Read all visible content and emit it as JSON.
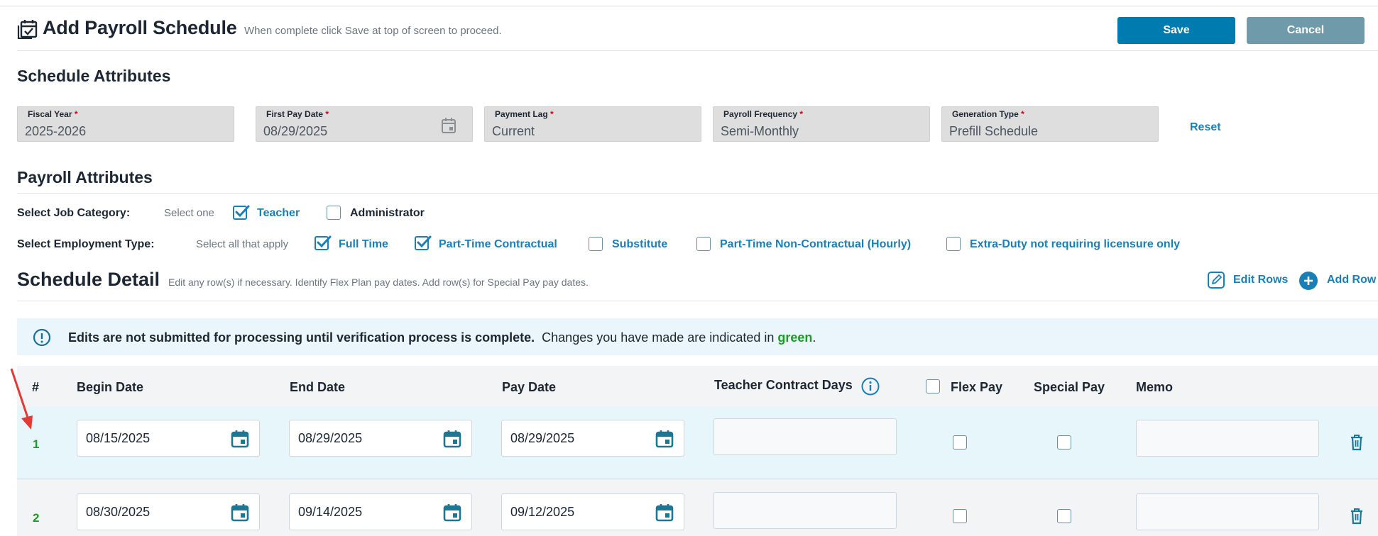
{
  "header": {
    "title": "Add Payroll Schedule",
    "subtitle": "When complete click Save at top of screen to proceed.",
    "save_label": "Save",
    "cancel_label": "Cancel"
  },
  "schedule_attributes": {
    "title": "Schedule Attributes",
    "fields": [
      {
        "label": "Fiscal Year",
        "value": "2025-2026",
        "required": true
      },
      {
        "label": "First Pay Date",
        "value": "08/29/2025",
        "required": true
      },
      {
        "label": "Payment Lag",
        "value": "Current",
        "required": true
      },
      {
        "label": "Payroll Frequency",
        "value": "Semi-Monthly",
        "required": true
      },
      {
        "label": "Generation Type",
        "value": "Prefill Schedule",
        "required": true
      }
    ],
    "required_mark": "*",
    "reset_label": "Reset"
  },
  "payroll_attributes": {
    "title": "Payroll Attributes",
    "job_category": {
      "label": "Select Job Category:",
      "hint": "Select one",
      "options": [
        {
          "label": "Teacher",
          "checked": true
        },
        {
          "label": "Administrator",
          "checked": false
        }
      ]
    },
    "employment_type": {
      "label": "Select Employment Type:",
      "hint": "Select all that apply",
      "options": [
        {
          "label": "Full Time",
          "checked": true
        },
        {
          "label": "Part-Time Contractual",
          "checked": true
        },
        {
          "label": "Substitute",
          "checked": false
        },
        {
          "label": "Part-Time Non-Contractual (Hourly)",
          "checked": false
        },
        {
          "label": "Extra-Duty not requiring licensure only",
          "checked": false
        }
      ]
    }
  },
  "schedule_detail": {
    "title": "Schedule Detail",
    "hint": "Edit any row(s) if necessary. Identify Flex Plan pay dates. Add row(s) for Special Pay pay dates.",
    "edit_rows_label": "Edit Rows",
    "add_row_label": "Add Row",
    "alert": {
      "bold": "Edits are not submitted for processing until verification process is complete.",
      "text": "Changes you have made are indicated in",
      "green_word": "green",
      "end": "."
    },
    "columns": [
      "#",
      "Begin Date",
      "End Date",
      "Pay Date",
      "Teacher Contract Days",
      "Flex Pay",
      "Special Pay",
      "Memo"
    ],
    "rows": [
      {
        "num": "1",
        "begin": "08/15/2025",
        "end": "08/29/2025",
        "pay": "08/29/2025"
      },
      {
        "num": "2",
        "begin": "08/30/2025",
        "end": "09/14/2025",
        "pay": "09/12/2025"
      }
    ]
  },
  "colors": {
    "primary": "#007bb0",
    "cancel": "#6f9aaa",
    "link": "#1a7fb5",
    "changed": "#1d9b2a",
    "annotation_arrow": "#e53935"
  }
}
